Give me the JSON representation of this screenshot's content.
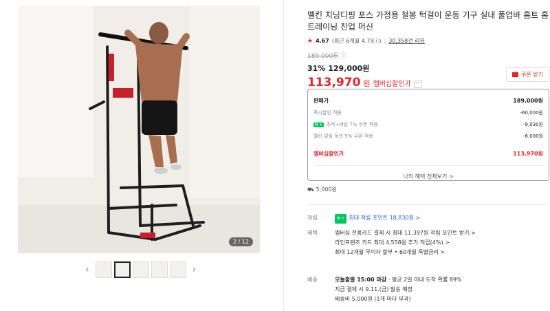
{
  "gallery": {
    "counter": "2 / 12",
    "prev_icon": "chevron-left-icon",
    "next_icon": "chevron-right-icon",
    "thumbnails": 5,
    "active_index": 1
  },
  "product": {
    "title": "멜킨 치닝디핑 포스 가정용 철봉 턱걸이 운동 기구 실내 풀업바 홈트 홈트레이닝 친업 머신",
    "rating": "4.67",
    "rating_detail": "(최근 6개월 4.79",
    "reviews": "30,358건 리뷰",
    "original_price": "189,000원",
    "discount_pct": "31%",
    "discount_price": "129,000원",
    "member_price": "113,970",
    "member_unit": "원",
    "member_label": "멤버십할인가",
    "coupon_label": "쿠폰 받기"
  },
  "price_box": {
    "head_label": "판매가",
    "head_value": "189,000원",
    "rows": [
      {
        "label": "즉시할인 적용",
        "value": "-60,000원"
      },
      {
        "label": "추석+세일 7% 쿠폰 적용",
        "value": "-9,030원"
      },
      {
        "label": "멜킨 알림 동의 5% 쿠폰 적용",
        "value": "-6,000원"
      }
    ],
    "total_label": "멤버십할인가",
    "total_value": "113,970원",
    "more_label": "나의 혜택 전체보기 >"
  },
  "shipping_fee": "5,000원",
  "points": {
    "label": "적립",
    "badge": "N +",
    "text": "최대 적립 포인트 18,830원 >"
  },
  "benefits": {
    "label": "혜택",
    "lines": [
      "멤버십 전용카드 결제 시 최대 11,397원 적립 포인트 받기 >",
      "라인프렌즈 카드 최대 4,558원 추가 적립(4%) >",
      "최대 12개월 무이자 할부 • 60개월 특별금리 >"
    ]
  },
  "delivery": {
    "label": "배송",
    "line1_bold": "오늘출발 15:00 마감",
    "line1_rest": " · 평균 2일 이내 도착 확률 89%",
    "line2": "지금 결제 시 9.11.(금) 발송 예정",
    "line3": "배송비 5,000원 (1개 마다 부과)"
  }
}
